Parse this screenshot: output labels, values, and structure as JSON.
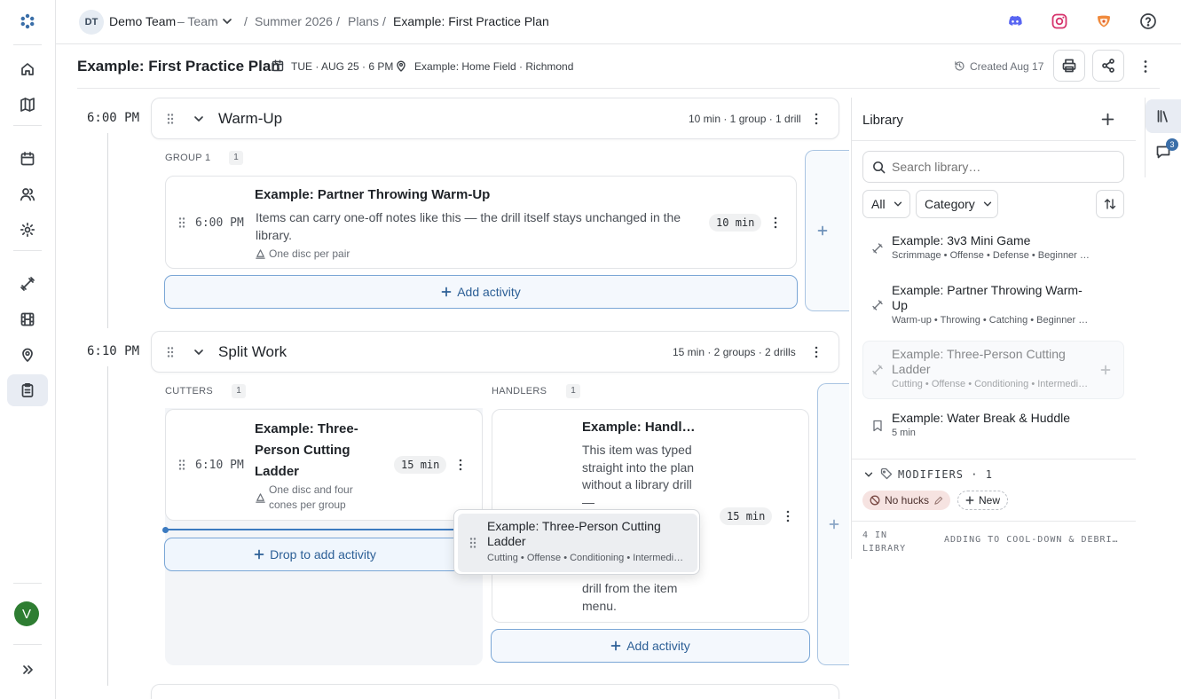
{
  "topbar": {
    "team_initials": "DT",
    "team_name": "Demo Team",
    "team_type": "– Team",
    "breadcrumb": [
      "Summer 2026",
      "Plans",
      "Example: First Practice Plan"
    ]
  },
  "plan": {
    "title": "Example: First Practice Plan",
    "date": "TUE · AUG 25 · 6 PM",
    "location": "Example: Home Field · Richmond",
    "created": "Created Aug 17"
  },
  "blocks": [
    {
      "time": "6:00 PM",
      "title": "Warm-Up",
      "summary": "10 min · 1 group · 1 drill",
      "groups": [
        {
          "label": "GROUP 1",
          "count": "1",
          "items": [
            {
              "title": "Example: Partner Throwing Warm-Up",
              "time": "6:00 PM",
              "note": "Items can carry one-off notes like this — the drill itself stays unchanged in the library.",
              "equipment": "One disc per pair",
              "duration": "10",
              "unit": "min"
            }
          ],
          "add_label": "Add activity"
        }
      ]
    },
    {
      "time": "6:10 PM",
      "title": "Split Work",
      "summary": "15 min · 2 groups · 2 drills",
      "groups": [
        {
          "label": "CUTTERS",
          "count": "1",
          "items": [
            {
              "title": "Example: Three-Person Cutting Ladder",
              "time": "6:10 PM",
              "equipment": "One disc and four cones per group",
              "duration": "15",
              "unit": "min"
            }
          ],
          "add_label": "Drop to add activity"
        },
        {
          "label": "HANDLERS",
          "count": "1",
          "items": [
            {
              "title": "Example: Handl…",
              "note_top": "This item was typed straight into the plan without a library drill —",
              "note_bottom": "drill from the item menu.",
              "duration": "15",
              "unit": "min"
            }
          ],
          "add_label": "Add activity"
        }
      ]
    }
  ],
  "drag_ghost": {
    "title": "Example: Three-Person Cutting Ladder",
    "tags": "Cutting • Offense • Conditioning • Intermedi…"
  },
  "library": {
    "title": "Library",
    "search_placeholder": "Search library…",
    "filter_all": "All",
    "filter_category": "Category",
    "items": [
      {
        "title": "Example: 3v3 Mini Game",
        "tags": "Scrimmage • Offense • Defense • Beginner …",
        "icon": "drill-icon"
      },
      {
        "title": "Example: Partner Throwing Warm-Up",
        "tags": "Warm-up • Throwing • Catching • Beginner …",
        "icon": "drill-icon"
      },
      {
        "title": "Example: Three-Person Cutting Ladder",
        "tags": "Cutting • Offense • Conditioning • Intermedi…",
        "icon": "drill-icon",
        "state": "dragging"
      },
      {
        "title": "Example: Water Break & Huddle",
        "tags": "5 min",
        "icon": "bookmark-icon"
      }
    ],
    "modifiers_label": "MODIFIERS · 1",
    "modifier_tag": "No hucks",
    "new_label": "New",
    "footer_count": "4 IN LIBRARY",
    "footer_status": "ADDING TO COOL-DOWN & DEBRI…"
  },
  "rail": {
    "comments_badge": "3"
  },
  "user": {
    "avatar_initial": "V"
  },
  "colors": {
    "accent": "#2c5f96",
    "drop_line": "#3b7ac0",
    "avatar": "#2e7d32",
    "tag_bg": "#f6e3e1"
  }
}
